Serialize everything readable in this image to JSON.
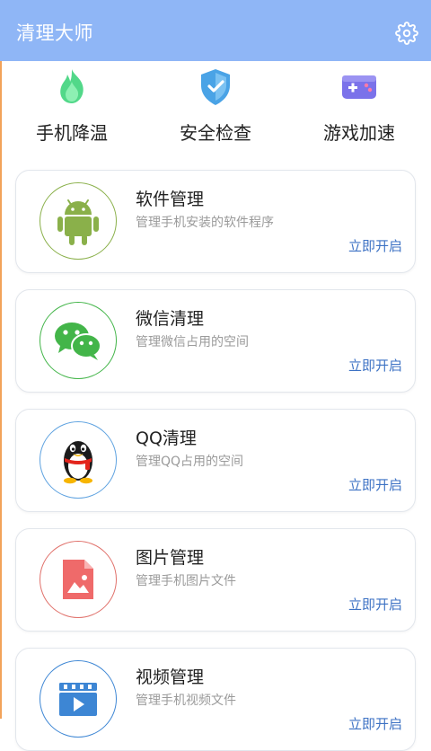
{
  "header": {
    "title": "清理大师",
    "settings_icon": "gear-icon",
    "background": "#8fb6f6"
  },
  "quick_actions": [
    {
      "label": "手机降温",
      "icon": "flame-icon",
      "color": "#4cd47e"
    },
    {
      "label": "安全检查",
      "icon": "shield-icon",
      "color": "#4da8e8"
    },
    {
      "label": "游戏加速",
      "icon": "gamepad-icon",
      "color": "#7a70e8"
    }
  ],
  "cards": [
    {
      "title": "软件管理",
      "desc": "管理手机安装的软件程序",
      "action": "立即开启",
      "icon": "android-icon",
      "ring_color": "#8ab04a"
    },
    {
      "title": "微信清理",
      "desc": "管理微信占用的空间",
      "action": "立即开启",
      "icon": "wechat-icon",
      "ring_color": "#43b549"
    },
    {
      "title": "QQ清理",
      "desc": "管理QQ占用的空间",
      "action": "立即开启",
      "icon": "qq-penguin-icon",
      "ring_color": "#5ea2e0"
    },
    {
      "title": "图片管理",
      "desc": "管理手机图片文件",
      "action": "立即开启",
      "icon": "image-file-icon",
      "ring_color": "#e0706a"
    },
    {
      "title": "视频管理",
      "desc": "管理手机视频文件",
      "action": "立即开启",
      "icon": "video-icon",
      "ring_color": "#3d86d4"
    }
  ],
  "colors": {
    "accent_link": "#3d72c4"
  }
}
